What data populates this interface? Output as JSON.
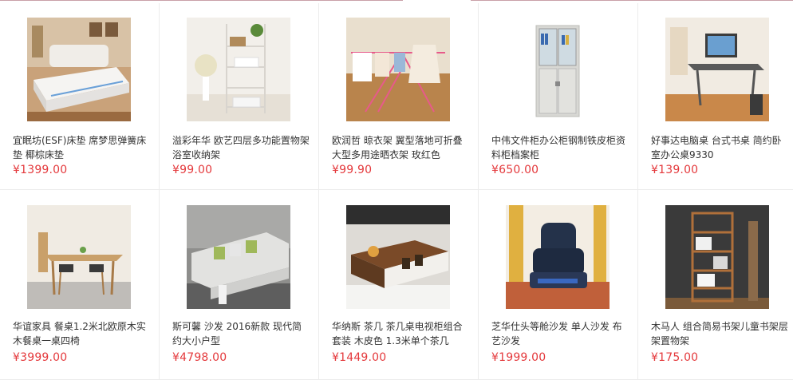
{
  "products": [
    {
      "title": "宜眠坊(ESF)床垫 席梦思弹簧床垫 椰棕床垫",
      "price": "¥1399.00",
      "icon": "mattress-bed-image"
    },
    {
      "title": "溢彩年华 欧艺四层多功能置物架 浴室收纳架",
      "price": "¥99.00",
      "icon": "storage-rack-image"
    },
    {
      "title": "欧润哲 晾衣架 翼型落地可折叠大型多用途晒衣架 玫红色",
      "price": "¥99.90",
      "icon": "drying-rack-image"
    },
    {
      "title": "中伟文件柜办公柜钢制铁皮柜资料柜档案柜",
      "price": "¥650.00",
      "icon": "file-cabinet-image"
    },
    {
      "title": "好事达电脑桌 台式书桌 简约卧室办公桌9330",
      "price": "¥139.00",
      "icon": "computer-desk-image"
    },
    {
      "title": "华谊家具 餐桌1.2米北欧原木实木餐桌一桌四椅",
      "price": "¥3999.00",
      "icon": "dining-set-image"
    },
    {
      "title": "斯可馨 沙发 2016新款 现代简约大小户型",
      "price": "¥4798.00",
      "icon": "sofa-image"
    },
    {
      "title": "华纳斯 茶几 茶几桌电视柜组合套装 木皮色 1.3米单个茶几",
      "price": "¥1449.00",
      "icon": "coffee-table-image"
    },
    {
      "title": "芝华仕头等舱沙发 单人沙发 布艺沙发",
      "price": "¥1999.00",
      "icon": "recliner-sofa-image"
    },
    {
      "title": "木马人 组合简易书架儿童书架层架置物架",
      "price": "¥175.00",
      "icon": "bookshelf-image"
    }
  ]
}
